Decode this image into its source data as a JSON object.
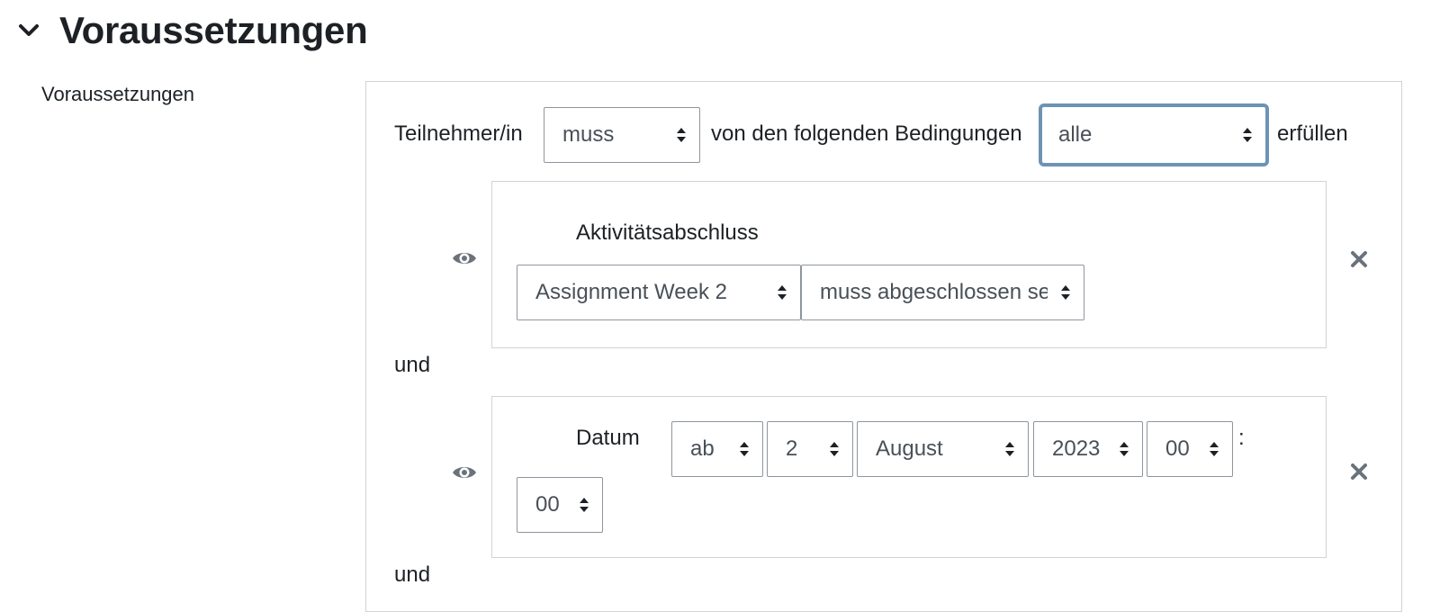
{
  "section": {
    "title": "Voraussetzungen",
    "field_label": "Voraussetzungen"
  },
  "rule": {
    "prefix": "Teilnehmer/in",
    "must_select": "muss",
    "middle": "von den folgenden Bedingungen",
    "scope_select": "alle",
    "suffix": "erfüllen"
  },
  "conditions": [
    {
      "type_label": "Aktivitätsabschluss",
      "activity_select": "Assignment Week 2",
      "state_select": "muss abgeschlossen sein"
    },
    {
      "type_label": "Datum",
      "direction_select": "ab",
      "day_select": "2",
      "month_select": "August",
      "year_select": "2023",
      "hour_select": "00",
      "separator": ":",
      "minute_select": "00"
    }
  ],
  "connectors": [
    "und",
    "und"
  ],
  "colors": {
    "focus_border": "#6d93b4",
    "icon": "#6a737b"
  },
  "icons": {
    "section_toggle": "chevron-down-icon",
    "visibility": "eye-icon",
    "remove": "close-icon",
    "select_arrows": "sort-arrows-icon"
  }
}
